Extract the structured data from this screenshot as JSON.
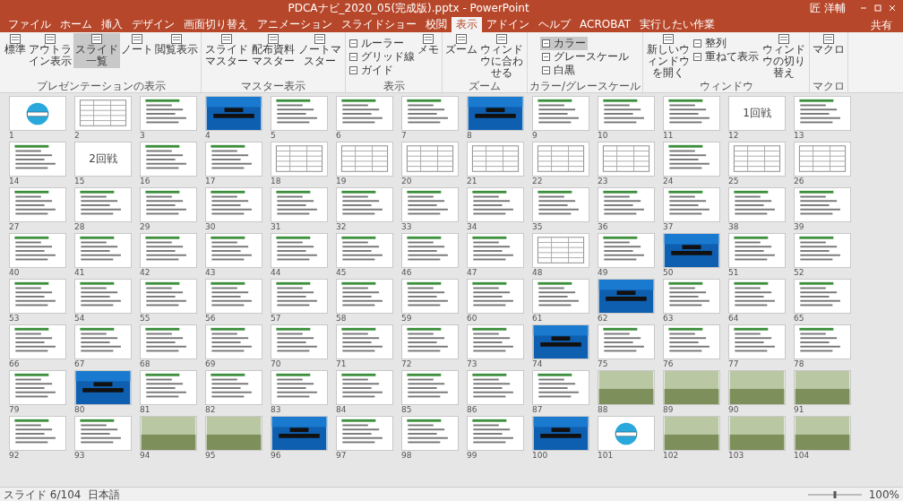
{
  "window": {
    "title": "PDCAナビ_2020_05(完成版).pptx - PowerPoint",
    "user": "匠 洋輔"
  },
  "ribbon_tabs": [
    {
      "label": "ファイル",
      "selected": false
    },
    {
      "label": "ホーム",
      "selected": false
    },
    {
      "label": "挿入",
      "selected": false
    },
    {
      "label": "デザイン",
      "selected": false
    },
    {
      "label": "画面切り替え",
      "selected": false
    },
    {
      "label": "アニメーション",
      "selected": false
    },
    {
      "label": "スライドショー",
      "selected": false
    },
    {
      "label": "校閲",
      "selected": false
    },
    {
      "label": "表示",
      "selected": true
    },
    {
      "label": "アドイン",
      "selected": false
    },
    {
      "label": "ヘルプ",
      "selected": false
    },
    {
      "label": "ACROBAT",
      "selected": false
    },
    {
      "label": "実行したい作業",
      "selected": false
    }
  ],
  "share": "共有",
  "ribbon_groups": [
    {
      "label": "プレゼンテーションの表示",
      "buttons": [
        {
          "label": "標準",
          "kind": "large",
          "selected": false
        },
        {
          "label": "アウトライン表示",
          "kind": "large",
          "selected": false
        },
        {
          "label": "スライド一覧",
          "kind": "large",
          "selected": true
        },
        {
          "label": "ノート",
          "kind": "large",
          "selected": false
        },
        {
          "label": "閲覧表示",
          "kind": "large",
          "selected": false
        }
      ]
    },
    {
      "label": "マスター表示",
      "buttons": [
        {
          "label": "スライドマスター",
          "kind": "large",
          "selected": false
        },
        {
          "label": "配布資料マスター",
          "kind": "large",
          "selected": false
        },
        {
          "label": "ノートマスター",
          "kind": "large",
          "selected": false
        }
      ]
    },
    {
      "label": "表示",
      "buttons": [
        {
          "label": "ルーラー",
          "kind": "small",
          "selected": false
        },
        {
          "label": "グリッド線",
          "kind": "small",
          "selected": false
        },
        {
          "label": "ガイド",
          "kind": "small",
          "selected": false
        },
        {
          "label": "メモ",
          "kind": "large",
          "selected": false
        }
      ]
    },
    {
      "label": "ズーム",
      "buttons": [
        {
          "label": "ズーム",
          "kind": "large",
          "selected": false
        },
        {
          "label": "ウィンドウに合わせる",
          "kind": "large",
          "selected": false
        }
      ]
    },
    {
      "label": "カラー/グレースケール",
      "buttons": [
        {
          "label": "カラー",
          "kind": "small",
          "selected": true
        },
        {
          "label": "グレースケール",
          "kind": "small",
          "selected": false
        },
        {
          "label": "白黒",
          "kind": "small",
          "selected": false
        }
      ]
    },
    {
      "label": "ウィンドウ",
      "buttons": [
        {
          "label": "新しいウィンドウを開く",
          "kind": "large",
          "selected": false
        },
        {
          "label": "整列",
          "kind": "small",
          "selected": false
        },
        {
          "label": "重ねて表示",
          "kind": "small",
          "selected": false
        },
        {
          "label": "ウィンドウの切り替え",
          "kind": "large",
          "selected": false
        }
      ]
    },
    {
      "label": "マクロ",
      "buttons": [
        {
          "label": "マクロ",
          "kind": "large",
          "selected": false
        }
      ]
    }
  ],
  "slides": [
    {
      "number": "1",
      "kind": "logo"
    },
    {
      "number": "2",
      "kind": "table"
    },
    {
      "number": "3",
      "kind": "text"
    },
    {
      "number": "4",
      "kind": "title"
    },
    {
      "number": "5",
      "kind": "text"
    },
    {
      "number": "6",
      "kind": "text"
    },
    {
      "number": "7",
      "kind": "text"
    },
    {
      "number": "8",
      "kind": "title"
    },
    {
      "number": "9",
      "kind": "text"
    },
    {
      "number": "10",
      "kind": "text"
    },
    {
      "number": "11",
      "kind": "text"
    },
    {
      "number": "12",
      "kind": "headline",
      "headline": "1回戦"
    },
    {
      "number": "13",
      "kind": "text"
    },
    {
      "number": "14",
      "kind": "text"
    },
    {
      "number": "15",
      "kind": "headline",
      "headline": "2回戦"
    },
    {
      "number": "16",
      "kind": "text"
    },
    {
      "number": "17",
      "kind": "text"
    },
    {
      "number": "18",
      "kind": "table"
    },
    {
      "number": "19",
      "kind": "table"
    },
    {
      "number": "20",
      "kind": "table"
    },
    {
      "number": "21",
      "kind": "table"
    },
    {
      "number": "22",
      "kind": "table"
    },
    {
      "number": "23",
      "kind": "table"
    },
    {
      "number": "24",
      "kind": "text"
    },
    {
      "number": "25",
      "kind": "table"
    },
    {
      "number": "26",
      "kind": "table"
    },
    {
      "number": "27",
      "kind": "text"
    },
    {
      "number": "28",
      "kind": "text"
    },
    {
      "number": "29",
      "kind": "text"
    },
    {
      "number": "30",
      "kind": "text"
    },
    {
      "number": "31",
      "kind": "text"
    },
    {
      "number": "32",
      "kind": "text"
    },
    {
      "number": "33",
      "kind": "text"
    },
    {
      "number": "34",
      "kind": "text"
    },
    {
      "number": "35",
      "kind": "text"
    },
    {
      "number": "36",
      "kind": "text"
    },
    {
      "number": "37",
      "kind": "text"
    },
    {
      "number": "38",
      "kind": "text"
    },
    {
      "number": "39",
      "kind": "text"
    },
    {
      "number": "40",
      "kind": "text"
    },
    {
      "number": "41",
      "kind": "text"
    },
    {
      "number": "42",
      "kind": "text"
    },
    {
      "number": "43",
      "kind": "text"
    },
    {
      "number": "44",
      "kind": "text"
    },
    {
      "number": "45",
      "kind": "text"
    },
    {
      "number": "46",
      "kind": "text"
    },
    {
      "number": "47",
      "kind": "text"
    },
    {
      "number": "48",
      "kind": "table"
    },
    {
      "number": "49",
      "kind": "text"
    },
    {
      "number": "50",
      "kind": "title"
    },
    {
      "number": "51",
      "kind": "text"
    },
    {
      "number": "52",
      "kind": "text"
    },
    {
      "number": "53",
      "kind": "text"
    },
    {
      "number": "54",
      "kind": "text"
    },
    {
      "number": "55",
      "kind": "text"
    },
    {
      "number": "56",
      "kind": "text"
    },
    {
      "number": "57",
      "kind": "text"
    },
    {
      "number": "58",
      "kind": "text"
    },
    {
      "number": "59",
      "kind": "text"
    },
    {
      "number": "60",
      "kind": "text"
    },
    {
      "number": "61",
      "kind": "text"
    },
    {
      "number": "62",
      "kind": "title"
    },
    {
      "number": "63",
      "kind": "text"
    },
    {
      "number": "64",
      "kind": "text"
    },
    {
      "number": "65",
      "kind": "text"
    },
    {
      "number": "66",
      "kind": "text"
    },
    {
      "number": "67",
      "kind": "text"
    },
    {
      "number": "68",
      "kind": "text"
    },
    {
      "number": "69",
      "kind": "text"
    },
    {
      "number": "70",
      "kind": "text"
    },
    {
      "number": "71",
      "kind": "text"
    },
    {
      "number": "72",
      "kind": "text"
    },
    {
      "number": "73",
      "kind": "text"
    },
    {
      "number": "74",
      "kind": "title"
    },
    {
      "number": "75",
      "kind": "text"
    },
    {
      "number": "76",
      "kind": "text"
    },
    {
      "number": "77",
      "kind": "text"
    },
    {
      "number": "78",
      "kind": "text"
    },
    {
      "number": "79",
      "kind": "text"
    },
    {
      "number": "80",
      "kind": "title"
    },
    {
      "number": "81",
      "kind": "text"
    },
    {
      "number": "82",
      "kind": "text"
    },
    {
      "number": "83",
      "kind": "text"
    },
    {
      "number": "84",
      "kind": "text"
    },
    {
      "number": "85",
      "kind": "text"
    },
    {
      "number": "86",
      "kind": "text"
    },
    {
      "number": "87",
      "kind": "text"
    },
    {
      "number": "88",
      "kind": "photo"
    },
    {
      "number": "89",
      "kind": "photo"
    },
    {
      "number": "90",
      "kind": "photo"
    },
    {
      "number": "91",
      "kind": "photo"
    },
    {
      "number": "92",
      "kind": "text"
    },
    {
      "number": "93",
      "kind": "text"
    },
    {
      "number": "94",
      "kind": "photo"
    },
    {
      "number": "95",
      "kind": "photo"
    },
    {
      "number": "96",
      "kind": "title"
    },
    {
      "number": "97",
      "kind": "text"
    },
    {
      "number": "98",
      "kind": "text"
    },
    {
      "number": "99",
      "kind": "text"
    },
    {
      "number": "100",
      "kind": "title"
    },
    {
      "number": "101",
      "kind": "logo"
    },
    {
      "number": "102",
      "kind": "photo"
    },
    {
      "number": "103",
      "kind": "photo"
    },
    {
      "number": "104",
      "kind": "photo"
    }
  ],
  "status_bar": {
    "slide": "スライド 6/104",
    "language": "日本語",
    "zoom_slider": {
      "level": 0.5
    },
    "zoom": "100%"
  }
}
